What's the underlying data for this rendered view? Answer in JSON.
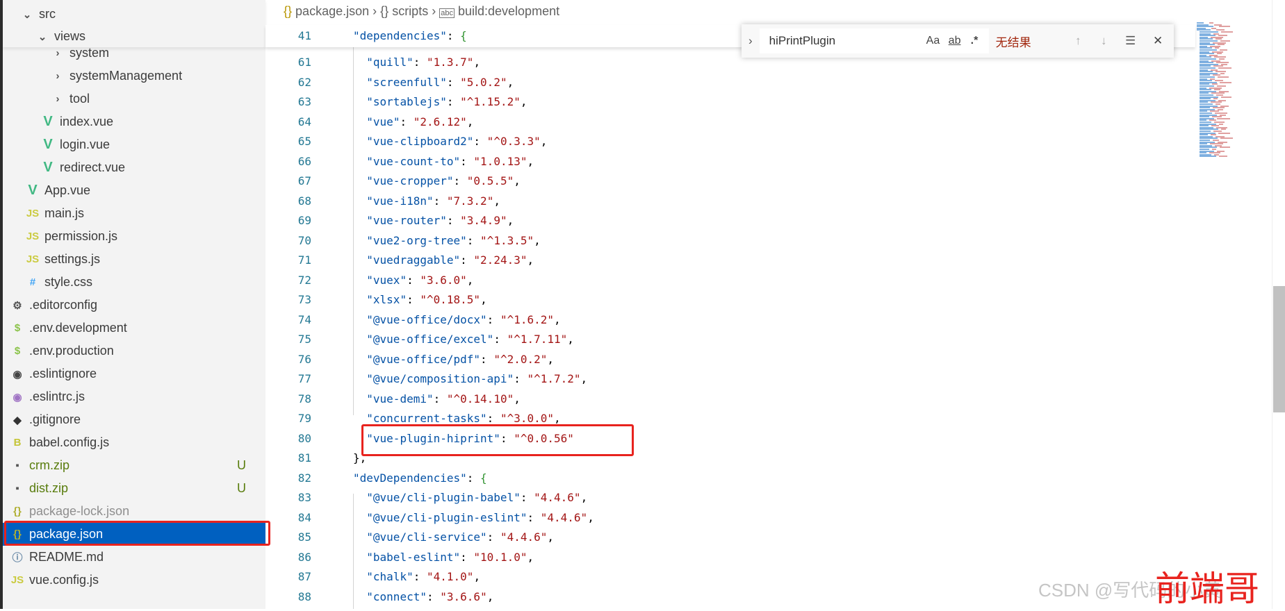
{
  "sidebar": {
    "sticky": [
      {
        "label": "src",
        "icon": "chevron-down-icon",
        "indent": 1
      },
      {
        "label": "views",
        "icon": "chevron-down-icon",
        "indent": 2
      }
    ],
    "items": [
      {
        "label": "system",
        "icon": "chevron-right-icon",
        "indent": 3
      },
      {
        "label": "systemManagement",
        "icon": "chevron-right-icon",
        "indent": 3
      },
      {
        "label": "tool",
        "icon": "chevron-right-icon",
        "indent": 3
      },
      {
        "label": "index.vue",
        "icon": "vue-icon",
        "indent": 3
      },
      {
        "label": "login.vue",
        "icon": "vue-icon",
        "indent": 3
      },
      {
        "label": "redirect.vue",
        "icon": "vue-icon",
        "indent": 3
      },
      {
        "label": "App.vue",
        "icon": "vue-icon",
        "indent": 2
      },
      {
        "label": "main.js",
        "icon": "js-icon",
        "indent": 2
      },
      {
        "label": "permission.js",
        "icon": "js-icon",
        "indent": 2
      },
      {
        "label": "settings.js",
        "icon": "js-icon",
        "indent": 2
      },
      {
        "label": "style.css",
        "icon": "css-icon",
        "indent": 2
      },
      {
        "label": ".editorconfig",
        "icon": "gear-icon",
        "indent": 1
      },
      {
        "label": ".env.development",
        "icon": "dollar-icon",
        "indent": 1
      },
      {
        "label": ".env.production",
        "icon": "dollar-icon",
        "indent": 1
      },
      {
        "label": ".eslintignore",
        "icon": "eslint-ignore-icon",
        "indent": 1
      },
      {
        "label": ".eslintrc.js",
        "icon": "eslint-icon",
        "indent": 1
      },
      {
        "label": ".gitignore",
        "icon": "git-icon",
        "indent": 1
      },
      {
        "label": "babel.config.js",
        "icon": "babel-icon",
        "indent": 1
      },
      {
        "label": "crm.zip",
        "icon": "zip-icon",
        "indent": 1,
        "badge": "U",
        "color": "#587c0c"
      },
      {
        "label": "dist.zip",
        "icon": "zip-icon",
        "indent": 1,
        "badge": "U",
        "color": "#587c0c"
      },
      {
        "label": "package-lock.json",
        "icon": "json-icon",
        "indent": 1,
        "color": "#8e8e8e"
      },
      {
        "label": "package.json",
        "icon": "json-icon",
        "indent": 1,
        "selected": true
      },
      {
        "label": "README.md",
        "icon": "info-icon",
        "indent": 1
      },
      {
        "label": "vue.config.js",
        "icon": "js-icon",
        "indent": 1
      }
    ]
  },
  "breadcrumb": [
    "package.json",
    "scripts",
    "build:development"
  ],
  "editor": {
    "sticky_line": {
      "n": "41",
      "key": "dependencies"
    },
    "lines": [
      {
        "n": "61",
        "k": "quill",
        "v": "1.3.7"
      },
      {
        "n": "62",
        "k": "screenfull",
        "v": "5.0.2"
      },
      {
        "n": "63",
        "k": "sortablejs",
        "v": "^1.15.2"
      },
      {
        "n": "64",
        "k": "vue",
        "v": "2.6.12"
      },
      {
        "n": "65",
        "k": "vue-clipboard2",
        "v": "^0.3.3"
      },
      {
        "n": "66",
        "k": "vue-count-to",
        "v": "1.0.13"
      },
      {
        "n": "67",
        "k": "vue-cropper",
        "v": "0.5.5"
      },
      {
        "n": "68",
        "k": "vue-i18n",
        "v": "7.3.2"
      },
      {
        "n": "69",
        "k": "vue-router",
        "v": "3.4.9"
      },
      {
        "n": "70",
        "k": "vue2-org-tree",
        "v": "^1.3.5"
      },
      {
        "n": "71",
        "k": "vuedraggable",
        "v": "2.24.3"
      },
      {
        "n": "72",
        "k": "vuex",
        "v": "3.6.0"
      },
      {
        "n": "73",
        "k": "xlsx",
        "v": "^0.18.5"
      },
      {
        "n": "74",
        "k": "@vue-office/docx",
        "v": "^1.6.2"
      },
      {
        "n": "75",
        "k": "@vue-office/excel",
        "v": "^1.7.11"
      },
      {
        "n": "76",
        "k": "@vue-office/pdf",
        "v": "^2.0.2"
      },
      {
        "n": "77",
        "k": "@vue/composition-api",
        "v": "^1.7.2"
      },
      {
        "n": "78",
        "k": "vue-demi",
        "v": "^0.14.10"
      },
      {
        "n": "79",
        "k": "concurrent-tasks",
        "v": "^3.0.0"
      },
      {
        "n": "80",
        "k": "vue-plugin-hiprint",
        "v": "^0.0.56",
        "last": true
      },
      {
        "n": "81",
        "close": "},"
      },
      {
        "n": "82",
        "k": "devDependencies",
        "open": true
      },
      {
        "n": "83",
        "k": "@vue/cli-plugin-babel",
        "v": "4.4.6"
      },
      {
        "n": "84",
        "k": "@vue/cli-plugin-eslint",
        "v": "4.4.6"
      },
      {
        "n": "85",
        "k": "@vue/cli-service",
        "v": "4.4.6"
      },
      {
        "n": "86",
        "k": "babel-eslint",
        "v": "10.1.0"
      },
      {
        "n": "87",
        "k": "chalk",
        "v": "4.1.0"
      },
      {
        "n": "88",
        "k": "connect",
        "v": "3.6.6"
      }
    ]
  },
  "find": {
    "query": "hiPrintPlugin",
    "match_case": "Aa",
    "whole_word": "ab",
    "regex": ".*",
    "result": "无结果",
    "result_color": "#a1260d"
  },
  "watermark": {
    "csdn": "CSDN @写代码的小黄",
    "overlay": "前端哥"
  }
}
